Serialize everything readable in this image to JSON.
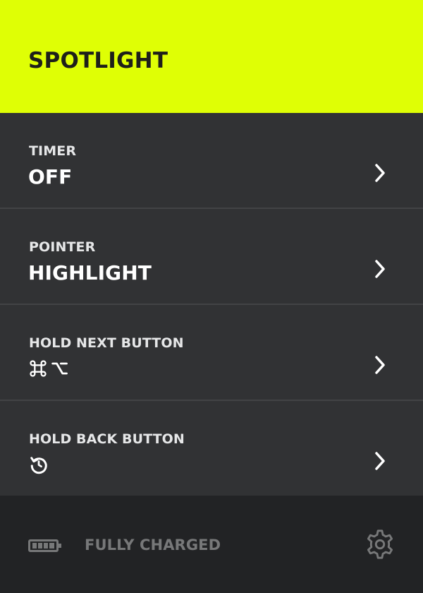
{
  "header": {
    "title": "SPOTLIGHT"
  },
  "settings": [
    {
      "label": "TIMER",
      "value": "OFF",
      "value_type": "text"
    },
    {
      "label": "POINTER",
      "value": "HIGHLIGHT",
      "value_type": "text"
    },
    {
      "label": "HOLD NEXT BUTTON",
      "value_icons": [
        "command-icon",
        "option-icon"
      ],
      "value_type": "icon"
    },
    {
      "label": "HOLD BACK BUTTON",
      "value_icons": [
        "restart-icon"
      ],
      "value_type": "icon"
    }
  ],
  "footer": {
    "battery_icon": "battery-full-icon",
    "status": "FULLY CHARGED",
    "settings_icon": "gear-icon"
  },
  "colors": {
    "accent": "#dfff05",
    "panel": "#313234",
    "footer": "#222325",
    "divider": "#424345",
    "muted_text": "#777879"
  }
}
